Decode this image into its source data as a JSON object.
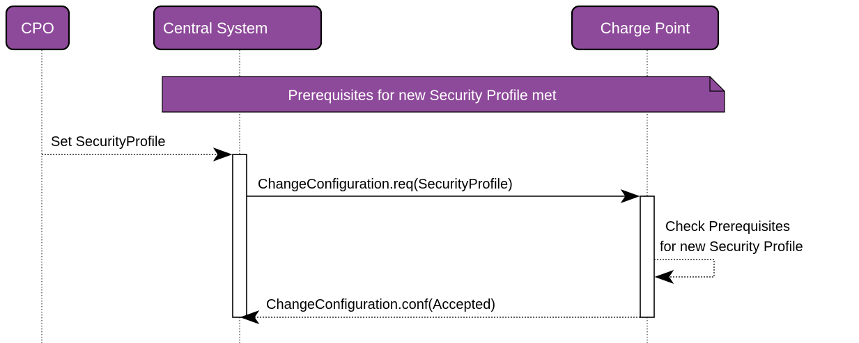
{
  "actors": [
    {
      "id": "cpo",
      "label": "CPO"
    },
    {
      "id": "central_system",
      "label": "Central System"
    },
    {
      "id": "charge_point",
      "label": "Charge Point"
    }
  ],
  "note": {
    "text": "Prerequisites for new Security Profile met"
  },
  "messages": [
    {
      "from": "CPO",
      "to": "Central System",
      "label": "Set SecurityProfile",
      "line": "dashed"
    },
    {
      "from": "Central System",
      "to": "Charge Point",
      "label": "ChangeConfiguration.req(SecurityProfile)",
      "line": "solid"
    },
    {
      "from": "Charge Point",
      "to": "Charge Point",
      "label_lines": [
        "Check Prerequisites",
        "for new Security Profile"
      ],
      "line": "dashed"
    },
    {
      "from": "Charge Point",
      "to": "Central System",
      "label": "ChangeConfiguration.conf(Accepted)",
      "line": "dashed"
    }
  ],
  "colors": {
    "actor_fill": "#8e4a9a",
    "note_fill": "#8e4a9a",
    "text_light": "#ffffff",
    "text_dark": "#000000"
  }
}
